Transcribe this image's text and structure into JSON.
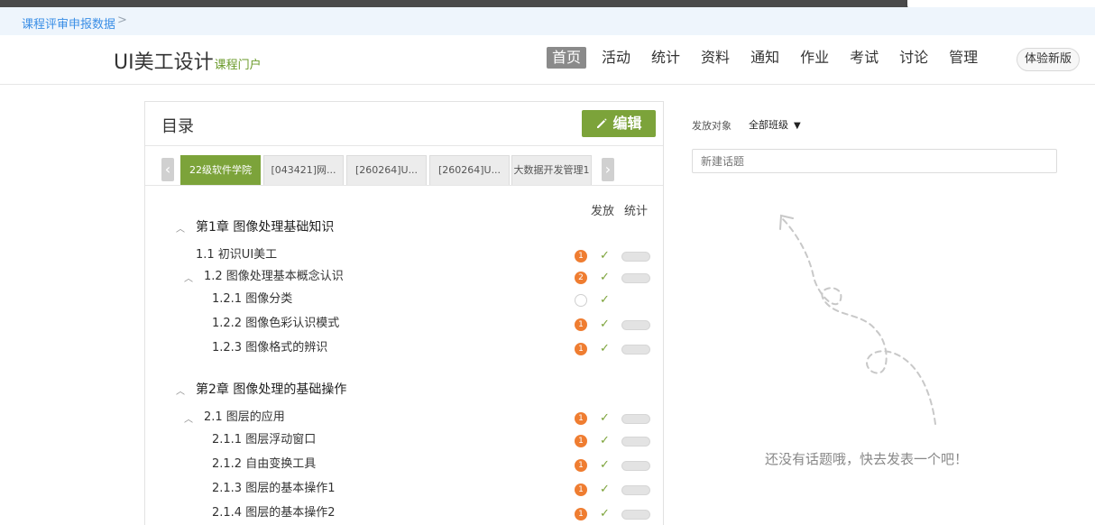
{
  "breadcrumb": {
    "label": "课程评审申报数据",
    "sep": ">"
  },
  "brand": {
    "title": "UI美工设计",
    "subtitle": "课程门户"
  },
  "nav": [
    "首页",
    "活动",
    "统计",
    "资料",
    "通知",
    "作业",
    "考试",
    "讨论",
    "管理"
  ],
  "nav_active": 0,
  "try_new": "体验新版",
  "catalog": {
    "title": "目录",
    "edit_label": "编辑",
    "tabs": [
      "22级软件学院",
      "[043421]网...",
      "[260264]U...",
      "[260264]U...",
      "大数据开发管理1"
    ],
    "active_tab": 0,
    "arrow_left": "‹",
    "arrow_right": "›",
    "col_release": "发放",
    "col_stats": "统计",
    "rows": [
      {
        "text": "第1章 图像处理基础知识",
        "type": "chapter"
      },
      {
        "text": "1.1  初识UI美工",
        "type": "section",
        "badge": "1"
      },
      {
        "text": "1.2  图像处理基本概念认识",
        "type": "section-exp",
        "badge": "2"
      },
      {
        "text": "1.2.1 图像分类",
        "type": "sub",
        "badge": ""
      },
      {
        "text": "1.2.2 图像色彩认识模式",
        "type": "sub",
        "badge": "1"
      },
      {
        "text": "1.2.3 图像格式的辨识",
        "type": "sub",
        "badge": "1"
      },
      {
        "text": "第2章 图像处理的基础操作",
        "type": "chapter"
      },
      {
        "text": "2.1  图层的应用",
        "type": "section-exp",
        "badge": "1"
      },
      {
        "text": "2.1.1 图层浮动窗口",
        "type": "sub",
        "badge": "1"
      },
      {
        "text": "2.1.2 自由变换工具",
        "type": "sub",
        "badge": "1"
      },
      {
        "text": "2.1.3 图层的基本操作1",
        "type": "sub",
        "badge": "1"
      },
      {
        "text": "2.1.4 图层的基本操作2",
        "type": "sub",
        "badge": "1"
      }
    ]
  },
  "discussion": {
    "target_label": "发放对象",
    "target_value": "全部班级",
    "new_topic_placeholder": "新建话题",
    "empty_text": "还没有话题哦，快去发表一个吧！"
  },
  "colors": {
    "green": "#7ca33a",
    "orange": "#ef7d31",
    "link": "#3a8ee6"
  }
}
